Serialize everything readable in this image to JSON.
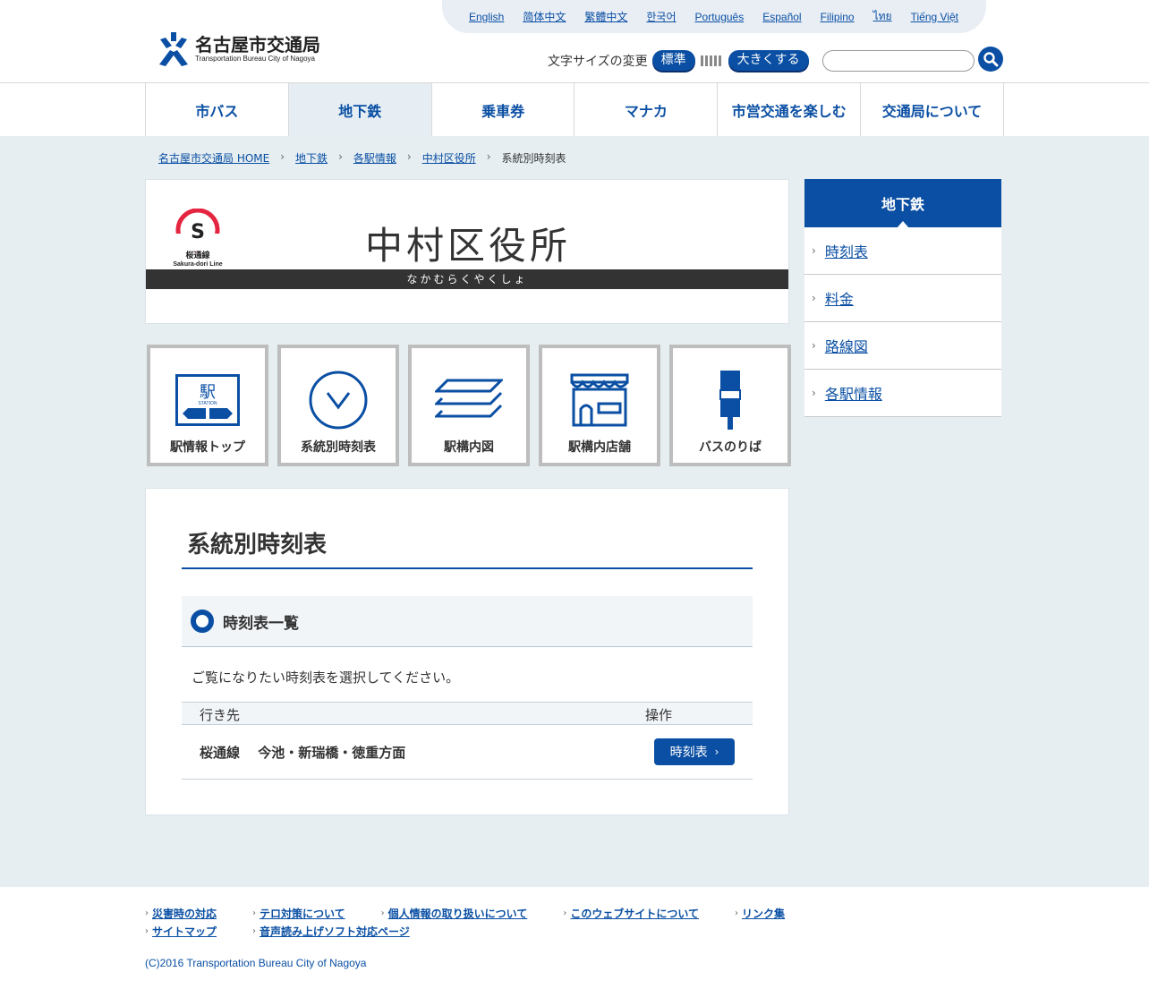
{
  "header": {
    "languages": [
      "English",
      "简体中文",
      "繁體中文",
      "한국어",
      "Português",
      "Español",
      "Filipino",
      "ไทย",
      "Tiếng Việt"
    ],
    "logo_jp": "名古屋市交通局",
    "logo_en": "Transportation Bureau City of Nagoya",
    "font_size_label": "文字サイズの変更",
    "font_standard": "標準",
    "font_larger": "大きくする",
    "search_value": ""
  },
  "nav": [
    "市バス",
    "地下鉄",
    "乗車券",
    "マナカ",
    "市営交通を楽しむ",
    "交通局について"
  ],
  "nav_active_index": 1,
  "breadcrumb": {
    "links": [
      "名古屋市交通局 HOME",
      "地下鉄",
      "各駅情報",
      "中村区役所"
    ],
    "current": "系統別時刻表"
  },
  "station": {
    "line_letter": "S",
    "line_jp": "桜通線",
    "line_en": "Sakura-dori Line",
    "line_color": "#e5243f",
    "name": "中村区役所",
    "kana": "なかむらくやくしょ"
  },
  "icon_cards": [
    {
      "label": "駅情報トップ",
      "icon": "station-icon",
      "glyph": "駅",
      "sub": "STATION"
    },
    {
      "label": "系統別時刻表",
      "icon": "clock-icon"
    },
    {
      "label": "駅構内図",
      "icon": "layers-icon"
    },
    {
      "label": "駅構内店舗",
      "icon": "shop-icon"
    },
    {
      "label": "バスのりば",
      "icon": "bus-stop-icon"
    }
  ],
  "content": {
    "title": "系統別時刻表",
    "subhead": "時刻表一覧",
    "instruction": "ご覧になりたい時刻表を選択してください。",
    "table": {
      "col_dest": "行き先",
      "col_action": "操作",
      "rows": [
        {
          "destination": "桜通線　 今池・新瑞橋・徳重方面",
          "button": "時刻表"
        }
      ]
    }
  },
  "sidebar": {
    "heading": "地下鉄",
    "items": [
      "時刻表",
      "料金",
      "路線図",
      "各駅情報"
    ]
  },
  "footer": {
    "links": [
      "災害時の対応",
      "テロ対策について",
      "個人情報の取り扱いについて",
      "このウェブサイトについて",
      "リンク集",
      "サイトマップ",
      "音声読み上げソフト対応ページ"
    ],
    "copyright": "(C)2016 Transportation Bureau City of Nagoya"
  },
  "colors": {
    "brand_blue": "#0a4fa3",
    "band_bg": "#e6eef1",
    "line_red": "#e5243f"
  }
}
